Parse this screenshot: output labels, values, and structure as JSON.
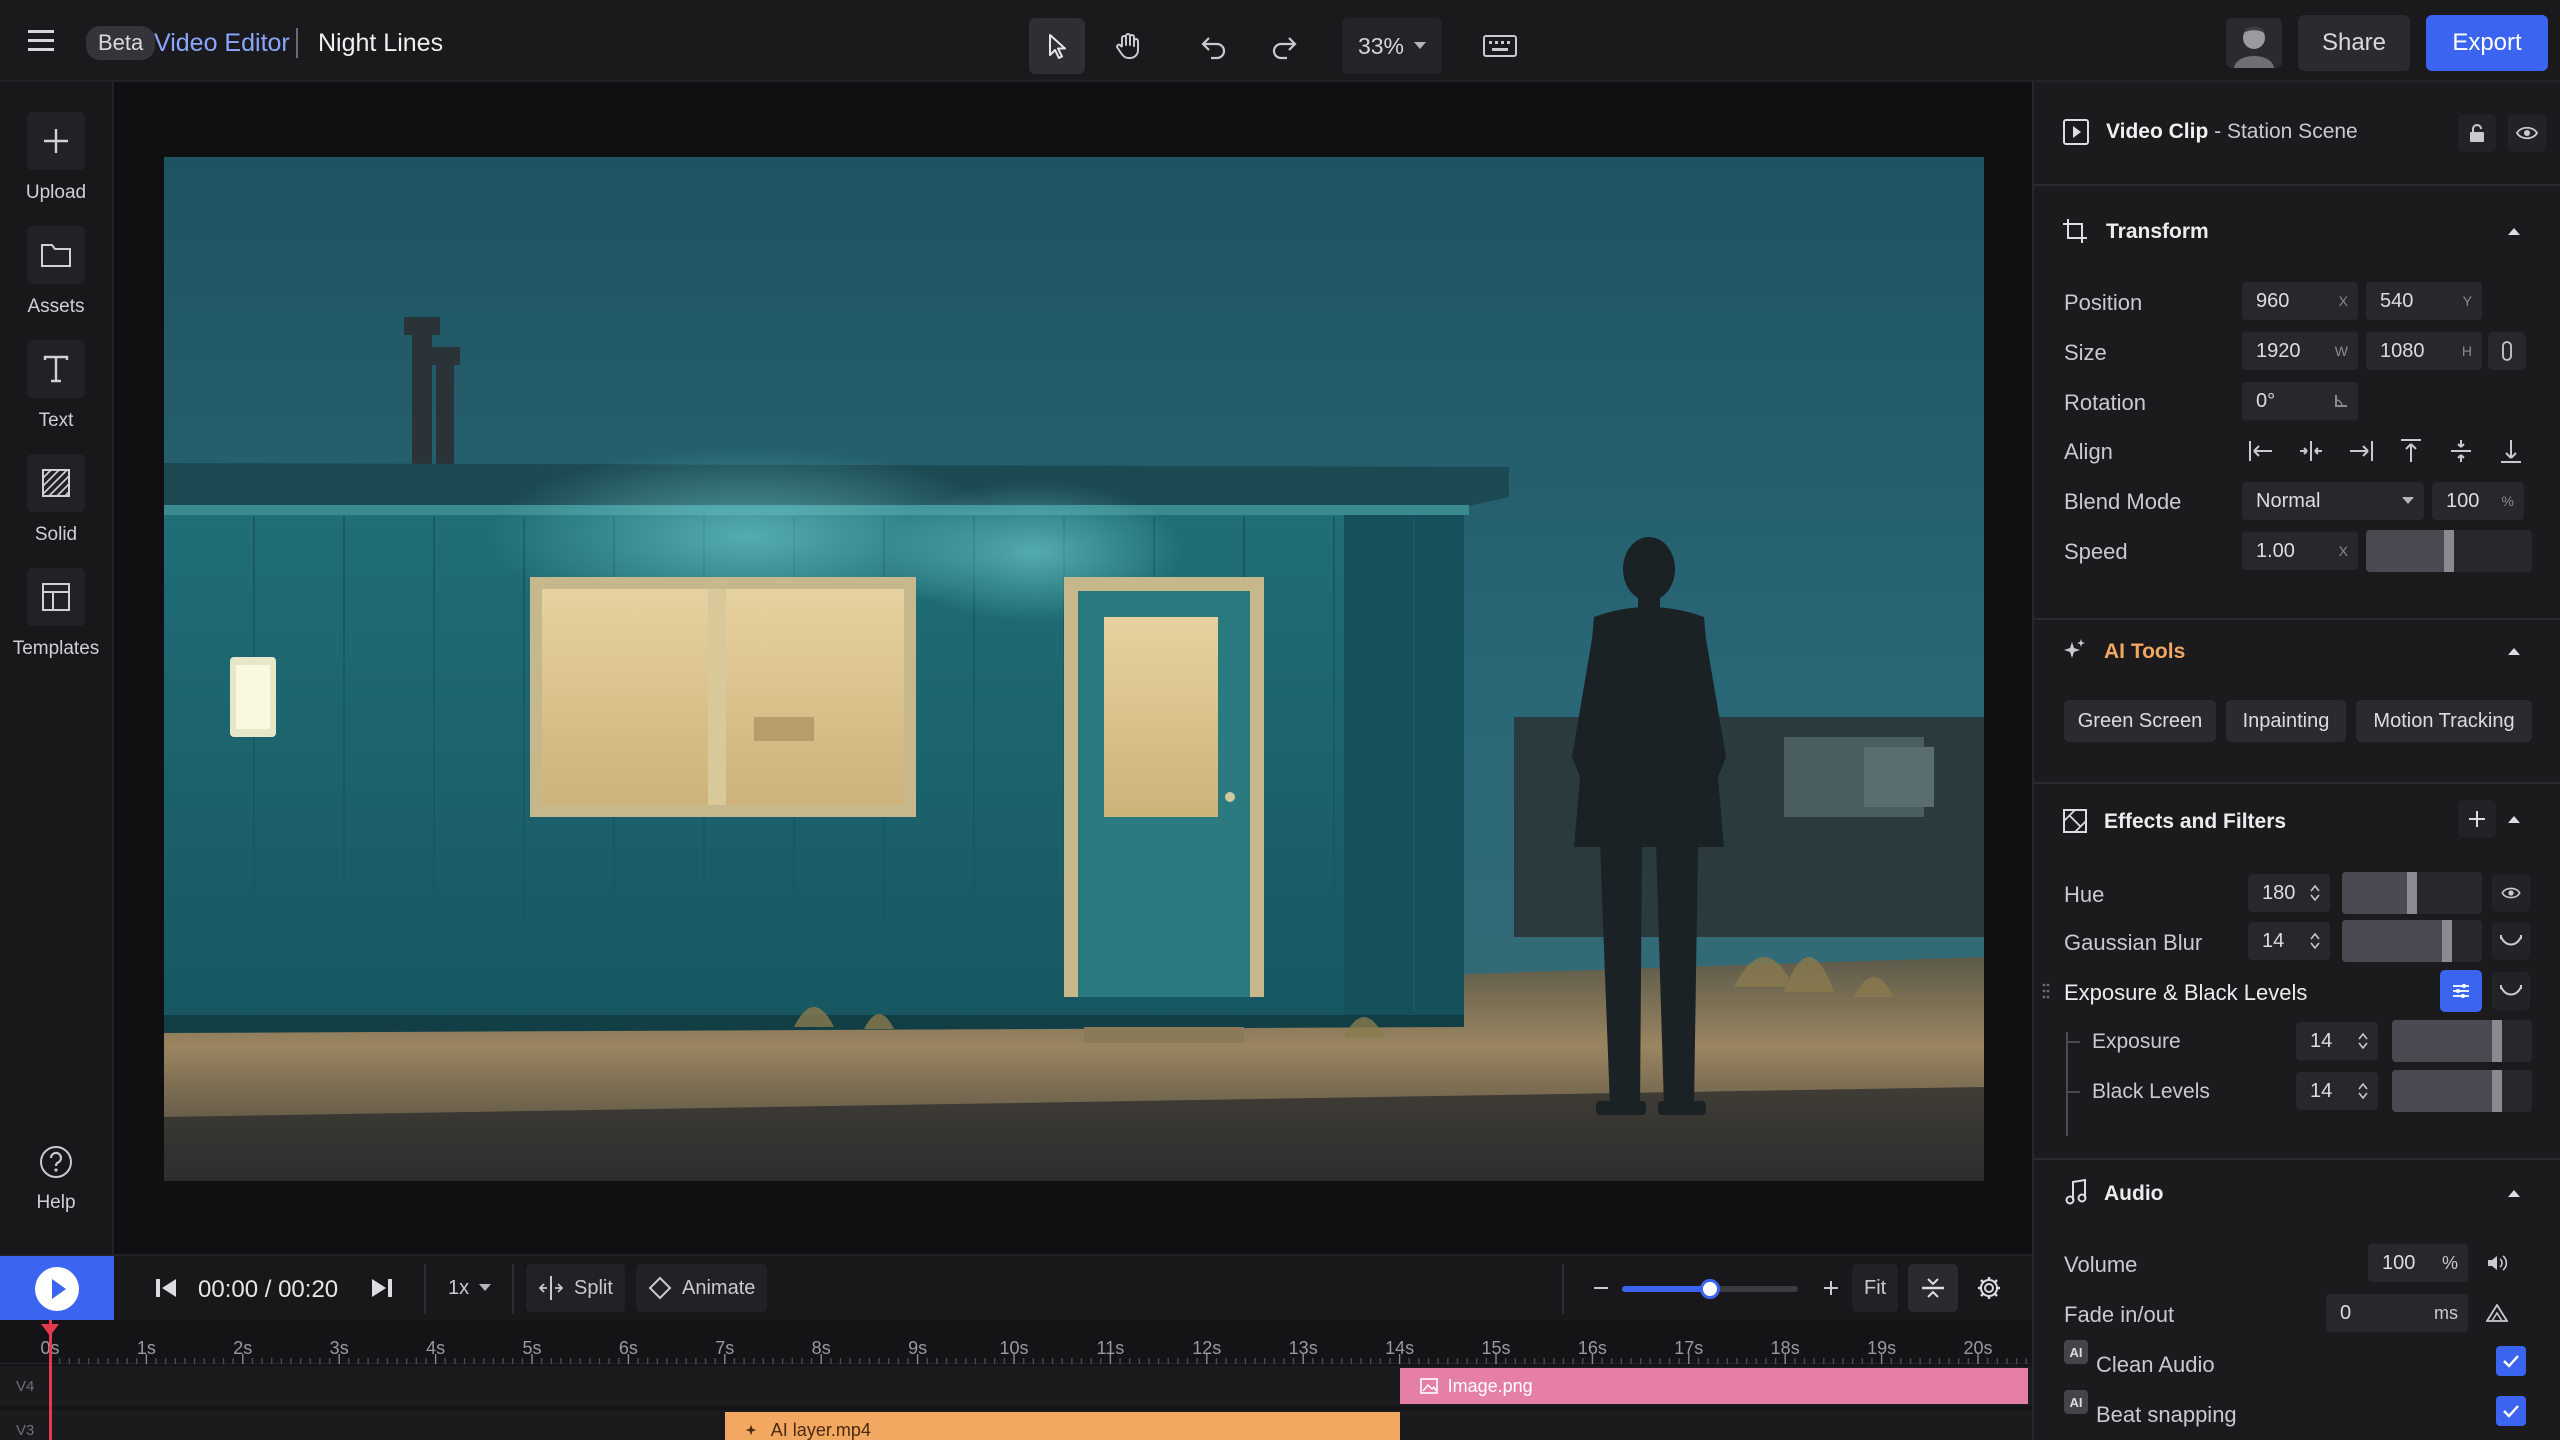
{
  "topbar": {
    "beta_badge": "Beta",
    "app_name": "Video Editor",
    "project_name": "Night Lines",
    "zoom_value": "33%",
    "share_label": "Share",
    "export_label": "Export"
  },
  "left_rail": {
    "items": [
      {
        "label": "Upload",
        "icon": "plus-icon"
      },
      {
        "label": "Assets",
        "icon": "folder-icon"
      },
      {
        "label": "Text",
        "icon": "text-icon"
      },
      {
        "label": "Solid",
        "icon": "hatched-square-icon"
      },
      {
        "label": "Templates",
        "icon": "layout-icon"
      }
    ],
    "help_label": "Help"
  },
  "panel": {
    "header": {
      "type": "Video Clip",
      "separator": " - ",
      "name": "Station Scene"
    },
    "transform": {
      "title": "Transform",
      "position_label": "Position",
      "position_x": "960",
      "position_x_unit": "X",
      "position_y": "540",
      "position_y_unit": "Y",
      "size_label": "Size",
      "size_w": "1920",
      "size_w_unit": "W",
      "size_h": "1080",
      "size_h_unit": "H",
      "rotation_label": "Rotation",
      "rotation_value": "0°",
      "align_label": "Align",
      "blend_label": "Blend Mode",
      "blend_value": "Normal",
      "opacity_value": "100",
      "opacity_unit": "%",
      "speed_label": "Speed",
      "speed_value": "1.00",
      "speed_unit": "X",
      "speed_fraction": 0.5
    },
    "ai_tools": {
      "title": "AI Tools",
      "buttons": [
        "Green Screen",
        "Inpainting",
        "Motion Tracking"
      ]
    },
    "effects": {
      "title": "Effects and Filters",
      "hue_label": "Hue",
      "hue_value": "180",
      "hue_fraction": 0.5,
      "blur_label": "Gaussian Blur",
      "blur_value": "14",
      "blur_fraction": 0.75,
      "exposure_group_label": "Exposure & Black Levels",
      "exposure_label": "Exposure",
      "exposure_value": "14",
      "exposure_fraction": 0.75,
      "black_label": "Black Levels",
      "black_value": "14",
      "black_fraction": 0.75
    },
    "audio": {
      "title": "Audio",
      "volume_label": "Volume",
      "volume_value": "100",
      "volume_unit": "%",
      "fade_label": "Fade in/out",
      "fade_value": "0",
      "fade_unit": "ms",
      "clean_audio_label": "Clean Audio",
      "clean_audio_badge": "AI",
      "beat_snapping_label": "Beat snapping",
      "beat_snapping_badge": "AI"
    }
  },
  "transport": {
    "time_current": "00:00",
    "time_separator": " / ",
    "time_total": "00:20",
    "speed_label": "1x",
    "split_label": "Split",
    "animate_label": "Animate",
    "fit_label": "Fit",
    "zoom_fraction": 0.5
  },
  "timeline": {
    "tick_labels": [
      "0s",
      "1s",
      "2s",
      "3s",
      "4s",
      "5s",
      "6s",
      "7s",
      "8s",
      "9s",
      "10s",
      "11s",
      "12s",
      "13s",
      "14s",
      "15s",
      "16s",
      "17s",
      "18s",
      "19s",
      "20s"
    ],
    "tracks": [
      "V4",
      "V3"
    ],
    "clips": [
      {
        "name": "Image.png",
        "track": "V4",
        "start": 14.0,
        "end": 20.6,
        "color": "#e57fa6"
      },
      {
        "name": "AI layer.mp4",
        "track": "V3",
        "start": 7.0,
        "end": 14.0,
        "color": "#f2a860"
      }
    ]
  },
  "colors": {
    "accent": "#3b64f0",
    "playhead": "#e53950"
  }
}
